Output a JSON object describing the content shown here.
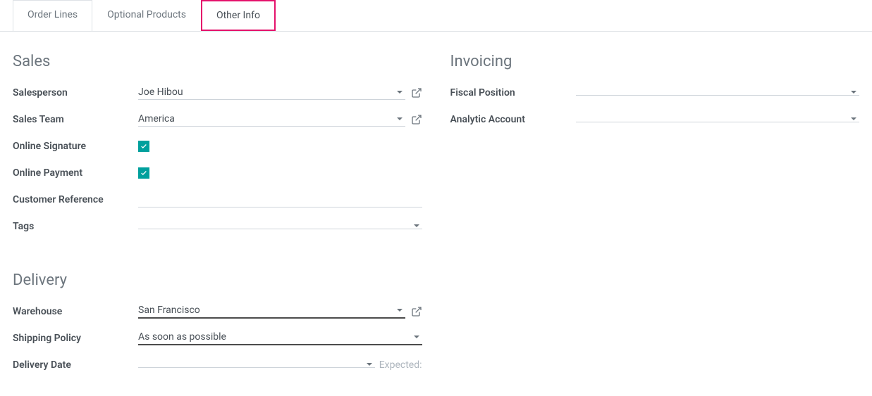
{
  "tabs": {
    "order_lines": "Order Lines",
    "optional_products": "Optional Products",
    "other_info": "Other Info"
  },
  "sales": {
    "title": "Sales",
    "salesperson_label": "Salesperson",
    "salesperson_value": "Joe Hibou",
    "sales_team_label": "Sales Team",
    "sales_team_value": "America",
    "online_signature_label": "Online Signature",
    "online_signature_checked": true,
    "online_payment_label": "Online Payment",
    "online_payment_checked": true,
    "customer_reference_label": "Customer Reference",
    "customer_reference_value": "",
    "tags_label": "Tags",
    "tags_value": ""
  },
  "invoicing": {
    "title": "Invoicing",
    "fiscal_position_label": "Fiscal Position",
    "fiscal_position_value": "",
    "analytic_account_label": "Analytic Account",
    "analytic_account_value": ""
  },
  "delivery": {
    "title": "Delivery",
    "warehouse_label": "Warehouse",
    "warehouse_value": "San Francisco",
    "shipping_policy_label": "Shipping Policy",
    "shipping_policy_value": "As soon as possible",
    "delivery_date_label": "Delivery Date",
    "delivery_date_value": "",
    "expected_label": "Expected:"
  }
}
